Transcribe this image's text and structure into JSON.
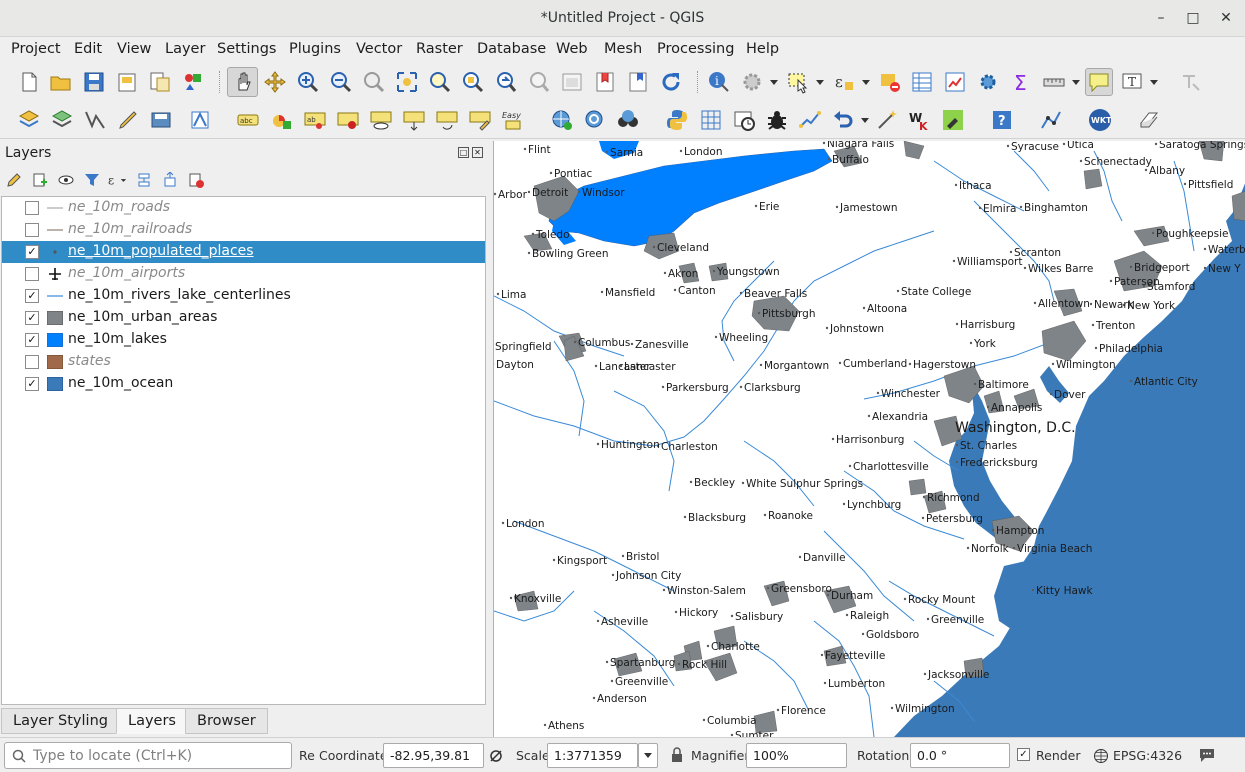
{
  "window": {
    "title": "*Untitled Project - QGIS"
  },
  "menu": [
    "Project",
    "Edit",
    "View",
    "Layer",
    "Settings",
    "Plugins",
    "Vector",
    "Raster",
    "Database",
    "Web",
    "Mesh",
    "Processing",
    "Help"
  ],
  "panel": {
    "title": "Layers"
  },
  "layers": [
    {
      "name": "ne_10m_roads",
      "checked": false,
      "symbol": "line-gray"
    },
    {
      "name": "ne_10m_railroads",
      "checked": false,
      "symbol": "line-gray"
    },
    {
      "name": "ne_10m_populated_places",
      "checked": true,
      "symbol": "point",
      "selected": true
    },
    {
      "name": "ne_10m_airports",
      "checked": false,
      "symbol": "airport"
    },
    {
      "name": "ne_10m_rivers_lake_centerlines",
      "checked": true,
      "symbol": "line-blue"
    },
    {
      "name": "ne_10m_urban_areas",
      "checked": true,
      "symbol": "fill-gray"
    },
    {
      "name": "ne_10m_lakes",
      "checked": true,
      "symbol": "fill-lake"
    },
    {
      "name": "states",
      "checked": false,
      "symbol": "fill-brown"
    },
    {
      "name": "ne_10m_ocean",
      "checked": true,
      "symbol": "fill-ocean"
    }
  ],
  "tabs": [
    "Layer Styling",
    "Layers",
    "Browser"
  ],
  "status": {
    "search_placeholder": "Type to locate (Ctrl+K)",
    "truncated": "Re",
    "coordinate_label": "Coordinate",
    "coordinate_value": "-82.95,39.81",
    "scale_label": "Scale",
    "scale_value": "1:3771359",
    "magnifier_label": "Magnifier",
    "magnifier_value": "100%",
    "rotation_label": "Rotation",
    "rotation_value": "0.0 °",
    "render_label": "Render",
    "crs": "EPSG:4326"
  },
  "colors": {
    "ocean": "#3a7ab8",
    "lake": "#0080ff",
    "urban": "#7f8488",
    "river": "#3a8ad6",
    "selection": "#308cc6"
  },
  "map_labels": {
    "bold_label": "Washington, D.C.",
    "places": [
      "Flint",
      "Sarnia",
      "London",
      "Niagara Falls",
      "Buffalo",
      "Syracuse",
      "Utica",
      "Saratoga Springs",
      "Schenectady",
      "Albany",
      "Pittsfield",
      "Pontiac",
      "Detroit",
      "Windsor",
      "Arbor",
      "Erie",
      "Jamestown",
      "Ithaca",
      "Elmira",
      "Binghamton",
      "Poughkeepsie",
      "Waterbu",
      "Toledo",
      "Bowling Green",
      "Cleveland",
      "Scranton",
      "Wilkes Barre",
      "Williamsport",
      "Bridgeport",
      "New Y",
      "Paterson",
      "Stamford",
      "Akron",
      "Youngstown",
      "Canton",
      "Lima",
      "Mansfield",
      "Beaver Falls",
      "State College",
      "Allentown",
      "Newark",
      "New York",
      "Pittsburgh",
      "Altoona",
      "Johnstown",
      "Harrisburg",
      "Trenton",
      "Springfield",
      "Columbus",
      "Zanesville",
      "Wheeling",
      "Lancaster",
      "Philadelphia",
      "Dayton",
      "Lancaster",
      "York",
      "Morgantown",
      "Cumberland",
      "Hagerstown",
      "Wilmington",
      "Parkersburg",
      "Clarksburg",
      "Baltimore",
      "Atlantic City",
      "Winchester",
      "Dover",
      "Annapolis",
      "Alexandria",
      "Huntington",
      "Charleston",
      "Harrisonburg",
      "St. Charles",
      "Charlottesville",
      "Fredericksburg",
      "Beckley",
      "White Sulphur Springs",
      "Lynchburg",
      "Richmond",
      "London",
      "Blacksburg",
      "Roanoke",
      "Petersburg",
      "Hampton",
      "Norfolk",
      "Virginia Beach",
      "Kingsport",
      "Bristol",
      "Danville",
      "Johnson City",
      "Winston-Salem",
      "Greensboro",
      "Durham",
      "Rocky Mount",
      "Kitty Hawk",
      "Knoxville",
      "Raleigh",
      "Hickory",
      "Salisbury",
      "Greenville",
      "Asheville",
      "Goldsboro",
      "Charlotte",
      "Spartanburg",
      "Rock Hill",
      "Fayetteville",
      "Greenville",
      "Jacksonville",
      "Lumberton",
      "Anderson",
      "Wilmington",
      "Florence",
      "Columbia",
      "Athens",
      "Sumter"
    ]
  }
}
